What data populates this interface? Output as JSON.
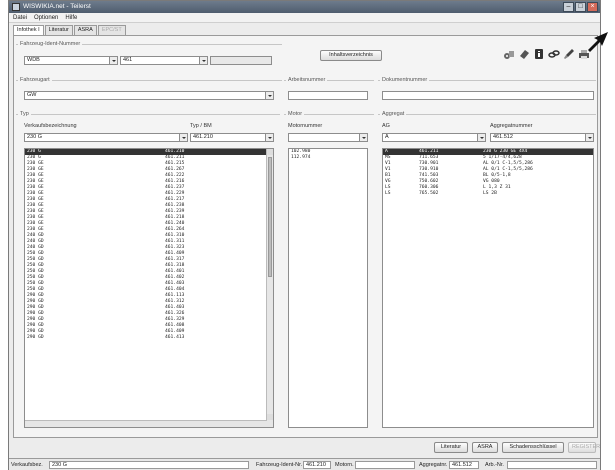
{
  "window": {
    "title": "WISWIKIA.net - Teilerst"
  },
  "menu": [
    "Datei",
    "Optionen",
    "Hilfe"
  ],
  "tabs": [
    {
      "label": "Infothek I",
      "state": "active"
    },
    {
      "label": "Literatur",
      "state": "normal"
    },
    {
      "label": "ASRA",
      "state": "normal"
    },
    {
      "label": "EPC/ST",
      "state": "disabled"
    }
  ],
  "fahrzeug": {
    "title": "Fahrzeug-Ident-Nummer",
    "value1": "WDB",
    "value2": "461",
    "value3": ""
  },
  "buttons": {
    "inhalt": "Inhaltsverzeichnis",
    "literatur": "Literatur",
    "asra": "ASRA",
    "schlussel": "Schadensschlüssel",
    "register": "REGISTER"
  },
  "icons": [
    "car-parts-icon",
    "eraser-icon",
    "info-icon",
    "chain-icon",
    "brush-icon",
    "printer-icon"
  ],
  "fahrzeugart": {
    "title": "Fahrzeugart",
    "value": "GW"
  },
  "arbeitsnummer": {
    "title": "Arbeitsnummer",
    "value": ""
  },
  "dokumentnummer": {
    "title": "Dokumentnummer",
    "value": ""
  },
  "typ": {
    "title": "Typ",
    "col1": "Verkaufsbezeichnung",
    "col2": "Typ / BM",
    "sel1": "230 G",
    "sel2": "461.210",
    "rows": [
      [
        "230 G",
        "461.210"
      ],
      [
        "230 G",
        "461.211"
      ],
      [
        "230 GE",
        "461.215"
      ],
      [
        "230 GE",
        "461.267"
      ],
      [
        "230 GE",
        "461.222"
      ],
      [
        "230 GE",
        "461.216"
      ],
      [
        "230 GE",
        "461.237"
      ],
      [
        "230 GE",
        "461.229"
      ],
      [
        "230 GE",
        "461.217"
      ],
      [
        "230 GE",
        "461.238"
      ],
      [
        "230 GE",
        "461.239"
      ],
      [
        "230 GE",
        "461.218"
      ],
      [
        "230 GE",
        "461.240"
      ],
      [
        "230 GE",
        "461.264"
      ],
      [
        "240 GD",
        "461.310"
      ],
      [
        "240 GD",
        "461.311"
      ],
      [
        "240 GD",
        "461.323"
      ],
      [
        "250 GD",
        "461.409"
      ],
      [
        "250 GD",
        "461.317"
      ],
      [
        "250 GD",
        "461.318"
      ],
      [
        "250 GD",
        "461.401"
      ],
      [
        "250 GD",
        "461.402"
      ],
      [
        "250 GD",
        "461.403"
      ],
      [
        "250 GD",
        "461.404"
      ],
      [
        "290 GD",
        "461.113"
      ],
      [
        "290 GD",
        "461.312"
      ],
      [
        "290 GD",
        "461.403"
      ],
      [
        "290 GD",
        "461.326"
      ],
      [
        "290 GD",
        "461.329"
      ],
      [
        "290 GD",
        "461.408"
      ],
      [
        "290 GD",
        "461.409"
      ],
      [
        "290 GD",
        "461.413"
      ]
    ]
  },
  "motor": {
    "title": "Motor",
    "col1": "Motornummer",
    "sel": "",
    "rows": [
      "102.980",
      "112.974"
    ]
  },
  "aggregat": {
    "title": "Aggregat",
    "col1": "AG",
    "col2": "Aggregatnummer",
    "sel1": "A",
    "sel2": "461.512",
    "rows": [
      [
        "A",
        "461.211",
        "230 G 230 GE 4X4"
      ],
      [
        "MS",
        "711.653",
        "5 1/17-4/4,628"
      ],
      [
        "V1",
        "730.901",
        "AL 0/1 C-1,5/5,286"
      ],
      [
        "V1",
        "730.910",
        "AL 0/1 C-1,5/5,286"
      ],
      [
        "B1",
        "741.503",
        "BL 0/5-1,8"
      ],
      [
        "VG",
        "750.602",
        "VG 080"
      ],
      [
        "LS",
        "760.306",
        "L 1,3 Z 31"
      ],
      [
        "LS",
        "765.502",
        "LS 2B"
      ]
    ]
  },
  "status": {
    "verkauf_label": "Verkaufsbez.",
    "verkauf_value": "230 G",
    "fin_label": "Fahrzeug-Ident-Nr.",
    "fin_value": "461.210",
    "motor_label": "Motorn.",
    "motor_value": "",
    "aggr_label": "Aggregatnr.",
    "aggr_value": "461.512",
    "arb_label": "Arb.-Nr.",
    "arb_value": ""
  }
}
